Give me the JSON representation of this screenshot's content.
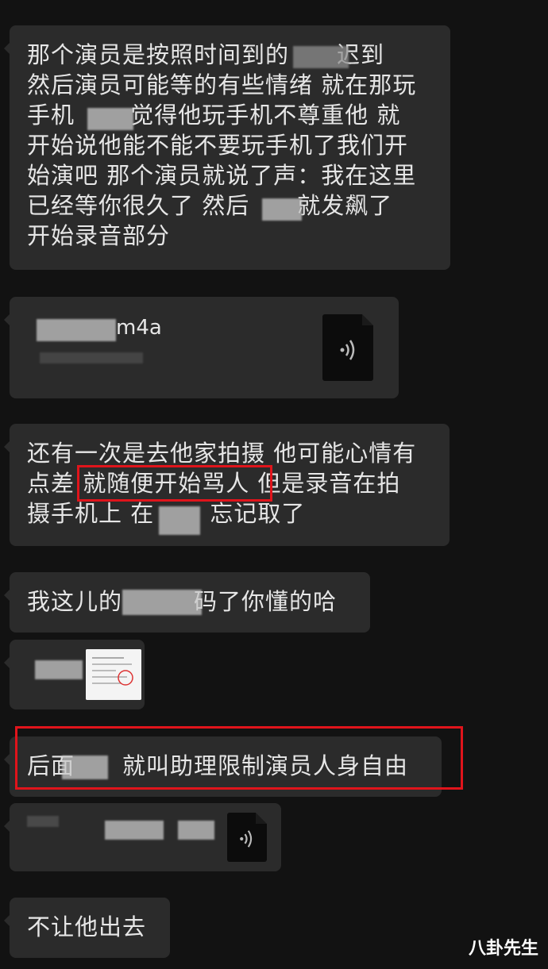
{
  "messages": [
    {
      "text": "那个演员是按照时间到的　　迟到\n然后演员可能等的有些情绪 就在那玩\n手机 　　觉得他玩手机不尊重他 就\n开始说他能不能不要玩手机了我们开\n始演吧 那个演员就说了声：我在这里\n已经等你很久了 然后　　就发飙了\n开始录音部分"
    },
    {
      "file_name": "m4a"
    },
    {
      "text": "还有一次是去他家拍摄 他可能心情有\n点差 就随便开始骂人 但是录音在拍\n摄手机上 在　　 忘记取了"
    },
    {
      "text": "我这儿的　　　码了你懂的哈"
    },
    {
      "image": "document-thumbnail"
    },
    {
      "text": "后面　　就叫助理限制演员人身自由"
    },
    {
      "file_name": ""
    },
    {
      "text": "不让他出去"
    }
  ],
  "watermark": "八卦先生",
  "colors": {
    "highlight": "#e0141b",
    "bubble": "#2b2b2b",
    "background": "#121212"
  }
}
